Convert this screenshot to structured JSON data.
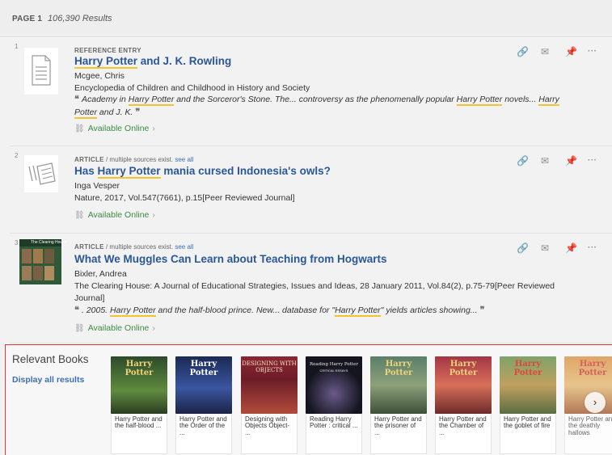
{
  "header": {
    "page_label": "PAGE 1",
    "results": "106,390 Results"
  },
  "records": [
    {
      "num": "1",
      "type": "REFERENCE ENTRY",
      "type_suffix": "",
      "see_all": "",
      "title_pre": "",
      "title_hl": "Harry Potter",
      "title_post": " and J. K. Rowling",
      "author": "Mcgee, Chris",
      "source": "Encyclopedia of Children and Childhood in History and Society",
      "snippet": {
        "s1": "Academy in ",
        "h1": "Harry Potter",
        "s2": " and the Sorceror's Stone. The... controversy as the phenomenally popular ",
        "h2": "Harry Potter",
        "s3": " novels... ",
        "h3": "Harry",
        "s4": " ",
        "h4": "Potter",
        "s5": " and J. K."
      },
      "availability": "Available Online"
    },
    {
      "num": "2",
      "type": "ARTICLE",
      "type_suffix": " / multiple sources exist. ",
      "see_all": "see all",
      "title_pre": "Has ",
      "title_hl": "Harry Potter",
      "title_post": " mania cursed Indonesia's owls?",
      "author": "Inga Vesper",
      "source": "Nature, 2017, Vol.547(7661), p.15[Peer Reviewed Journal]",
      "availability": "Available Online"
    },
    {
      "num": "3",
      "type": "ARTICLE",
      "type_suffix": " / multiple sources exist. ",
      "see_all": "see all",
      "title": "What We Muggles Can Learn about Teaching from Hogwarts",
      "author": "Bixler, Andrea",
      "source_line1": "The Clearing House: A Journal of Educational Strategies, Issues and Ideas, 28 January 2011, Vol.84(2), p.75-79[Peer Reviewed",
      "source_line2": "Journal]",
      "thumb_text": "The Clearing House",
      "snippet": {
        "s1": ". 2005. ",
        "h1": "Harry Potter",
        "s2": " and the half-blood prince. New... database for \"",
        "h2": "Harry Potter",
        "s3": "\" yields articles showing..."
      },
      "availability": "Available Online"
    }
  ],
  "actions": {
    "link_icon": "link-icon",
    "email_icon": "email-icon",
    "pin_icon": "pin-icon",
    "more_label": "···"
  },
  "relevant_books": {
    "title": "Relevant Books",
    "display_all": "Display all results",
    "books": [
      {
        "cover_title": "Harry Potter",
        "cover_sub": "",
        "label": "Harry Potter and the half-blood ...",
        "color": "#3c6b3a"
      },
      {
        "cover_title": "Harry Potter",
        "cover_sub": "",
        "label": "Harry Potter and the Order of the ...",
        "color": "#2d3f6b"
      },
      {
        "cover_title": "DESIGNING WITH OBJECTS",
        "cover_sub": "",
        "label": "Designing with Objects Object- ...",
        "color": "#7a2430"
      },
      {
        "cover_title": "Reading Harry Potter",
        "cover_sub": "CRITICAL ESSAYS",
        "label": "Reading Harry Potter : critical ...",
        "color": "#1e1f2a"
      },
      {
        "cover_title": "Harry Potter",
        "cover_sub": "",
        "label": "Harry Potter and the prisoner of ...",
        "color": "#4f6a4a"
      },
      {
        "cover_title": "Harry Potter",
        "cover_sub": "",
        "label": "Harry Potter and the Chamber of ...",
        "color": "#8a2d3a"
      },
      {
        "cover_title": "Harry Potter",
        "cover_sub": "",
        "label": "Harry Potter and the goblet of fire",
        "color": "#5c7a52"
      },
      {
        "cover_title": "Harry Potter",
        "cover_sub": "",
        "label": "Harry Potter and the deathly hallows",
        "color": "#c56a2a"
      }
    ],
    "next_label": "›"
  }
}
